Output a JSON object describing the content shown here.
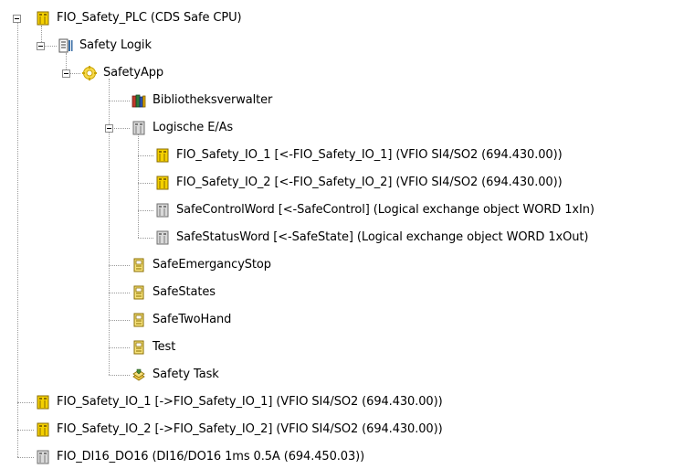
{
  "tree": {
    "items": [
      {
        "label": "FIO_Safety_PLC (CDS Safe CPU)",
        "icon": "plc-device-icon"
      },
      {
        "label": "Safety Logik",
        "icon": "application-icon"
      },
      {
        "label": "SafetyApp",
        "icon": "safety-app-icon"
      },
      {
        "label": "Bibliotheksverwalter",
        "icon": "library-manager-icon"
      },
      {
        "label": "Logische E/As",
        "icon": "logical-io-folder-icon"
      },
      {
        "label": "FIO_Safety_IO_1 [<-FIO_Safety_IO_1]  (VFIO SI4/SO2 (694.430.00))",
        "icon": "io-device-icon"
      },
      {
        "label": "FIO_Safety_IO_2 [<-FIO_Safety_IO_2]  (VFIO SI4/SO2 (694.430.00))",
        "icon": "io-device-icon"
      },
      {
        "label": "SafeControlWord [<-SafeControl]  (Logical exchange object WORD 1xIn)",
        "icon": "exchange-object-icon"
      },
      {
        "label": "SafeStatusWord [<-SafeState]  (Logical exchange object WORD 1xOut)",
        "icon": "exchange-object-icon"
      },
      {
        "label": "SafeEmergancyStop",
        "icon": "pou-icon"
      },
      {
        "label": "SafeStates",
        "icon": "pou-icon"
      },
      {
        "label": "SafeTwoHand",
        "icon": "pou-icon"
      },
      {
        "label": "Test",
        "icon": "pou-icon"
      },
      {
        "label": "Safety Task",
        "icon": "task-icon"
      },
      {
        "label": "FIO_Safety_IO_1 [->FIO_Safety_IO_1]  (VFIO SI4/SO2 (694.430.00))",
        "icon": "io-device-icon"
      },
      {
        "label": "FIO_Safety_IO_2 [->FIO_Safety_IO_2]  (VFIO SI4/SO2 (694.430.00))",
        "icon": "io-device-icon"
      },
      {
        "label": "FIO_DI16_DO16 (DI16/DO16 1ms 0.5A (694.450.03))",
        "icon": "generic-device-icon"
      }
    ]
  }
}
